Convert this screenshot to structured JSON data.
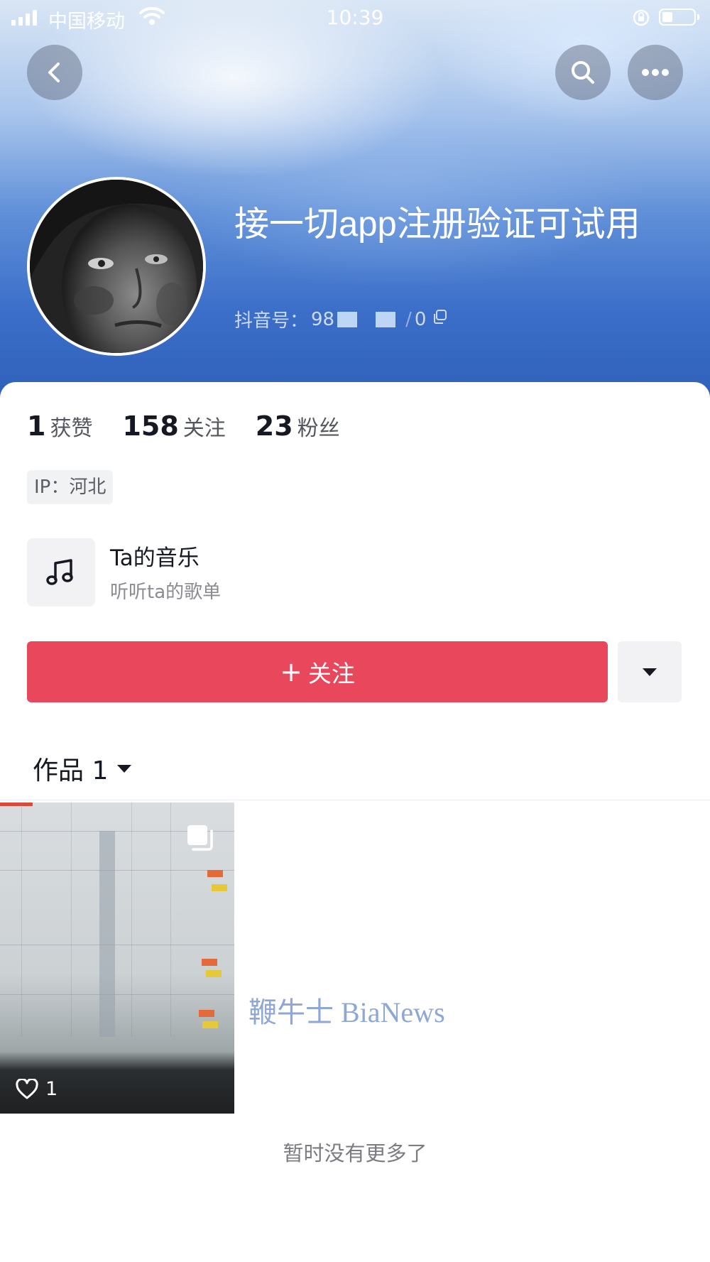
{
  "status_bar": {
    "carrier": "中国移动",
    "time": "10:39",
    "icons": [
      "signal-icon",
      "wifi-icon",
      "rotation-lock-icon",
      "battery-icon"
    ]
  },
  "nav": {
    "icons": [
      "back-icon",
      "search-icon",
      "more-icon"
    ]
  },
  "profile": {
    "name": "接一切app注册验证可试用",
    "id_label": "抖音号：",
    "id_visible_start": "98",
    "id_visible_end": "0",
    "id_partial": "/"
  },
  "stats": [
    {
      "value": "1",
      "label": "获赞"
    },
    {
      "value": "158",
      "label": "关注"
    },
    {
      "value": "23",
      "label": "粉丝"
    }
  ],
  "ip_tag": "IP：河北",
  "music": {
    "title": "Ta的音乐",
    "subtitle": "听听ta的歌单",
    "icon": "music-note-icon"
  },
  "actions": {
    "follow_label": "关注",
    "follow_prefix": "+",
    "dropdown_icon": "caret-down-icon"
  },
  "works": {
    "tab_label": "作品 1",
    "items": [
      {
        "likes": "1",
        "icon": "heart-icon",
        "multi_icon": "multi-image-icon"
      }
    ]
  },
  "watermark": "鞭牛士 BiaNews",
  "footer": {
    "no_more": "暂时没有更多了"
  },
  "colors": {
    "follow_button": "#e8475c",
    "header_blue": "#3c6fc9",
    "watermark": "#8da7d6"
  }
}
